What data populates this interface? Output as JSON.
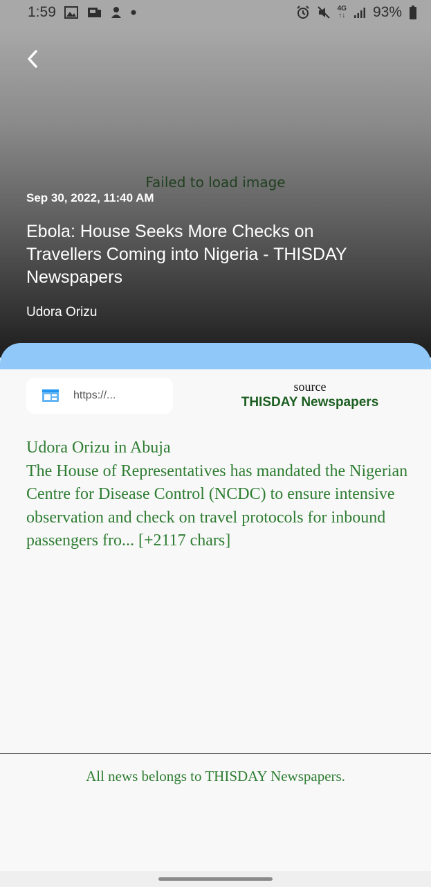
{
  "status_bar": {
    "time": "1:59",
    "battery": "93%",
    "network": "4G"
  },
  "hero": {
    "image_error": "Failed to load image",
    "date": "Sep 30, 2022, 11:40 AM",
    "title": "Ebola: House Seeks More Checks on Travellers Coming into Nigeria - THISDAY Newspapers",
    "author": "Udora Orizu"
  },
  "source": {
    "url_text": "https://...",
    "label": "source",
    "name": "THISDAY Newspapers"
  },
  "article": {
    "paragraphs": [
      "Udora Orizu in Abuja",
      "The House of Representatives has mandated the Nigerian Centre for Disease Control (NCDC) to ensure intensive observation and check on travel protocols for inbound passengers fro... [+2117 chars]"
    ]
  },
  "footer": {
    "note": "All news belongs to THISDAY Newspapers."
  },
  "colors": {
    "accent_blue": "#90c9f9",
    "text_green": "#2e7d32",
    "source_green": "#1b5e20"
  }
}
